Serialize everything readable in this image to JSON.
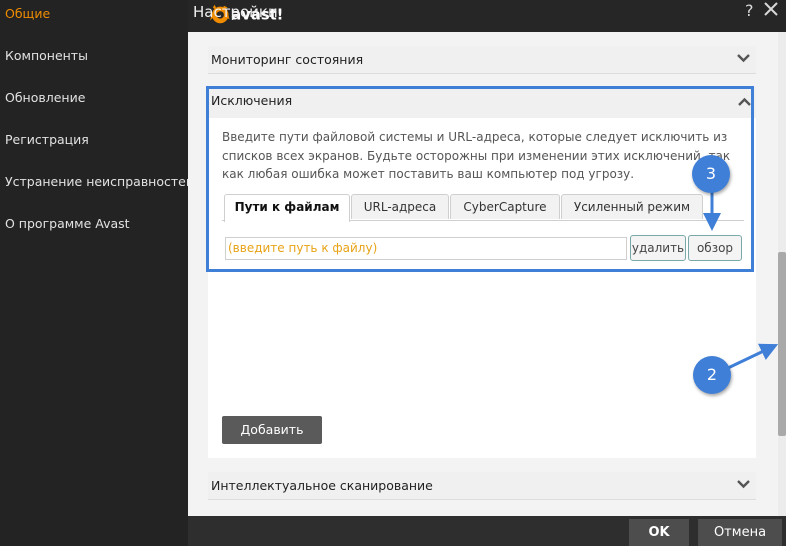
{
  "sidebar": {
    "items": [
      {
        "label": "Общие",
        "active": true
      },
      {
        "label": "Компоненты"
      },
      {
        "label": "Обновление"
      },
      {
        "label": "Регистрация"
      },
      {
        "label": "Устранение неисправностей"
      },
      {
        "label": "О программе Avast"
      }
    ]
  },
  "titlebar": {
    "logo_text": "avast!",
    "title": "Настройки",
    "help": "?",
    "close_icon": "close-icon"
  },
  "sections": {
    "monitoring": "Мониторинг состояния",
    "exclusions": "Исключения",
    "smart_scan": "Интеллектуальное сканирование"
  },
  "exclusions": {
    "description": "Введите пути файловой системы и URL-адреса, которые следует исключить из списков всех экранов. Будьте осторожны при изменении этих исключений, так как любая ошибка может поставить ваш компьютер под угрозу.",
    "tabs": [
      {
        "label": "Пути к файлам",
        "active": true
      },
      {
        "label": "URL-адреса"
      },
      {
        "label": "CyberCapture"
      },
      {
        "label": "Усиленный режим"
      }
    ],
    "path_placeholder": "(введите путь к файлу)",
    "delete_label": "удалить",
    "browse_label": "обзор",
    "add_label": "Добавить"
  },
  "footer": {
    "ok": "OK",
    "cancel": "Отмена"
  },
  "annotations": {
    "badge_3": "3",
    "badge_2": "2",
    "color": "#3f7fd8"
  },
  "colors": {
    "accent": "#f08c00",
    "placeholder": "#e8a317"
  }
}
